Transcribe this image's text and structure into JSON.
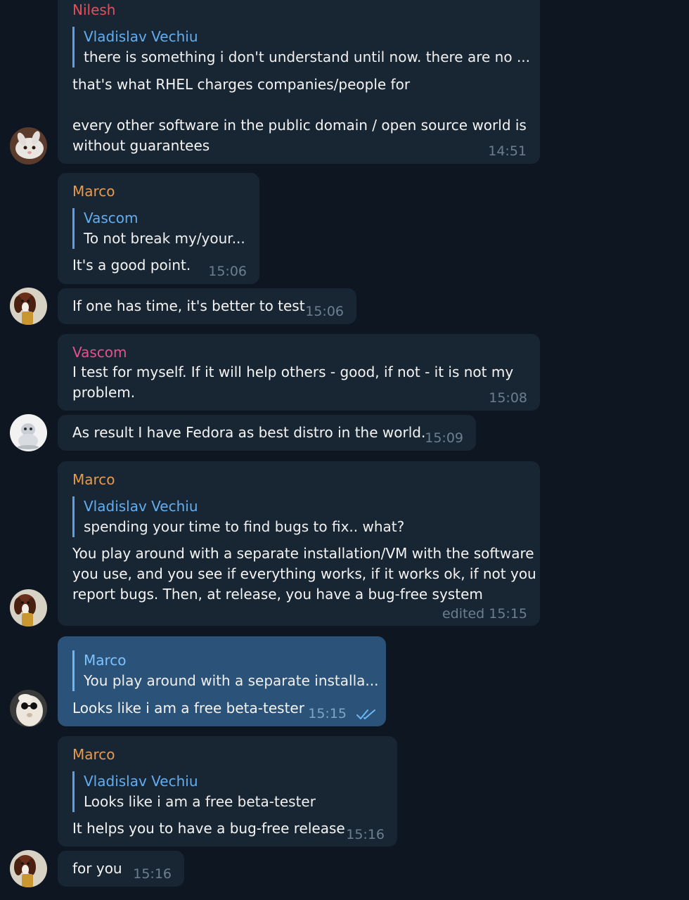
{
  "colors": {
    "background": "#0e1621",
    "bubble": "#182533",
    "own_bubble": "#2b5278",
    "name_nilesh": "#e3505b",
    "name_marco": "#e89a4d",
    "name_vascom": "#e8508e",
    "reply_name": "#62aef0"
  },
  "messages": {
    "m1": {
      "sender": "Nilesh",
      "reply_name": "Vladislav Vechiu",
      "reply_text": "there is something i don't understand until now. there are no ...",
      "text": "that's what RHEL charges companies/people for\n\nevery other software in the public domain / open source world is\nwithout guarantees",
      "time": "14:51",
      "avatar_icon": "rabbit-avatar-icon"
    },
    "m2": {
      "sender": "Marco",
      "reply_name": "Vascom",
      "reply_text": "To not break my/your...",
      "text": "It's a good point.",
      "time": "15:06"
    },
    "m3": {
      "text": "If one has time, it's better to test",
      "time": "15:06",
      "avatar_icon": "dog-avatar-icon"
    },
    "m4": {
      "sender": "Vascom",
      "text": "I test for myself. If it will help others - good, if not - it is not my\nproblem.",
      "time": "15:08"
    },
    "m5": {
      "text": "As result I have Fedora as best distro in the world.",
      "time": "15:09",
      "avatar_icon": "robot-avatar-icon"
    },
    "m6": {
      "sender": "Marco",
      "reply_name": "Vladislav Vechiu",
      "reply_text": "spending your time to find bugs to fix.. what?",
      "text": "You play around with a separate installation/VM with the software\nyou use, and you see if everything works, if it works ok, if not you\nreport bugs. Then, at release, you have a bug-free system",
      "time": "edited 15:15",
      "avatar_icon": "dog-avatar-icon"
    },
    "m7": {
      "reply_name": "Marco",
      "reply_text": "You play around with a separate installa...",
      "text": "Looks like i am a free beta-tester",
      "time": "15:15",
      "status_icon": "double-check-icon",
      "avatar_icon": "sunglasses-avatar-icon"
    },
    "m8": {
      "sender": "Marco",
      "reply_name": "Vladislav Vechiu",
      "reply_text": "Looks like i am a free beta-tester",
      "text": "It helps you to have a bug-free release",
      "time": "15:16"
    },
    "m9": {
      "text": "for you",
      "time": "15:16",
      "avatar_icon": "dog-avatar-icon"
    }
  }
}
